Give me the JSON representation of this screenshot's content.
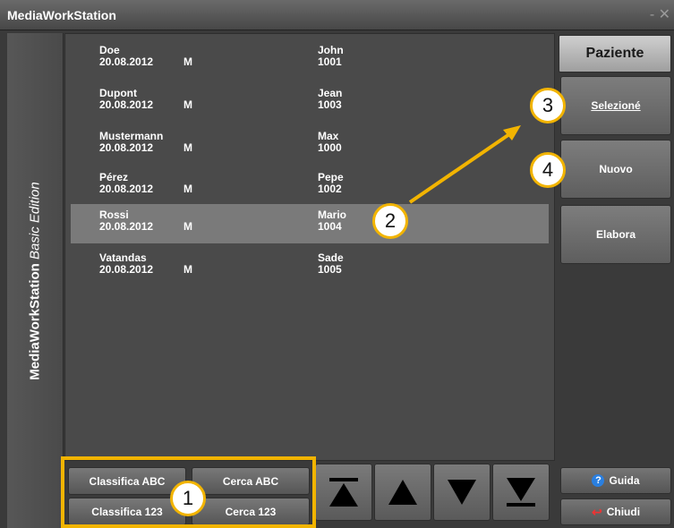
{
  "window": {
    "title": "MediaWorkStation",
    "controls": "- ✕"
  },
  "sidebar": {
    "app_name": "MediaWorkStation",
    "edition": "Basic Edition"
  },
  "patients": [
    {
      "last": "Doe",
      "dob": "20.08.2012",
      "sex": "M",
      "first": "John",
      "id": "1001"
    },
    {
      "last": "Dupont",
      "dob": "20.08.2012",
      "sex": "M",
      "first": "Jean",
      "id": "1003"
    },
    {
      "last": "Mustermann",
      "dob": "20.08.2012",
      "sex": "M",
      "first": "Max",
      "id": "1000"
    },
    {
      "last": "Pérez",
      "dob": "20.08.2012",
      "sex": "M",
      "first": "Pepe",
      "id": "1002"
    },
    {
      "last": "Rossi",
      "dob": "20.08.2012",
      "sex": "M",
      "first": "Mario",
      "id": "1004"
    },
    {
      "last": "Vatandas",
      "dob": "20.08.2012",
      "sex": "M",
      "first": "Sade",
      "id": "1005"
    }
  ],
  "selected_patient": "Rossi",
  "right_panel": {
    "header": "Paziente",
    "select_label": "Selezioné",
    "new_label": "Nuovo",
    "edit_label": "Elabora",
    "help_label": "Guida",
    "close_label": "Chiudi"
  },
  "bottom": {
    "sort_abc": "Classifica ABC",
    "search_abc": "Cerca ABC",
    "sort_123": "Classifica 123",
    "search_123": "Cerca 123"
  },
  "navigation": {
    "first_icon": "jump-to-top-icon",
    "up_icon": "arrow-up-icon",
    "down_icon": "arrow-down-icon",
    "last_icon": "jump-to-bottom-icon"
  },
  "annotations": {
    "callout_1": "1",
    "callout_2": "2",
    "callout_3": "3",
    "callout_4": "4",
    "highlight_color": "#f2b400"
  },
  "colors": {
    "background": "#3a3a3a",
    "list_background": "#4a4a4a",
    "selected_row": "#7a7a7a",
    "accent": "#f2b400"
  }
}
